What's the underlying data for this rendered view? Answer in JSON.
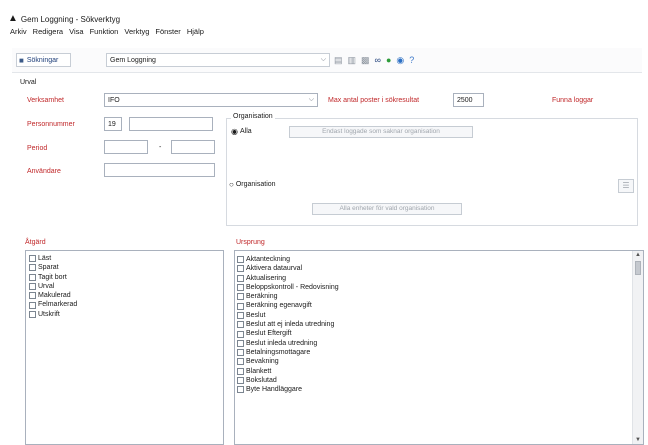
{
  "window": {
    "title": "Gem Loggning - Sökverktyg"
  },
  "menu": [
    "Arkiv",
    "Redigera",
    "Visa",
    "Funktion",
    "Verktyg",
    "Fönster",
    "Hjälp"
  ],
  "toolbar": {
    "saved_search_label": "Sökningar",
    "saved_search_value": "Gem Loggning"
  },
  "urval": {
    "section_label": "Urval",
    "verksamhet_label": "Verksamhet",
    "verksamhet_value": "IFO",
    "max_label": "Max antal poster i sökresultat",
    "max_value": "2500",
    "funna_label": "Funna loggar",
    "personnummer_label": "Personnummer",
    "personnummer_prefix": "19",
    "period_label": "Period",
    "period_separator": "-",
    "anvandare_label": "Användare"
  },
  "organisation": {
    "group_label": "Organisation",
    "radio_alla": "Alla",
    "alla_hint": "Endast loggade som saknar organisation",
    "radio_org": "Organisation",
    "org_button": "Alla enheter för vald organisation"
  },
  "atgard": {
    "label": "Åtgärd",
    "items": [
      "Läst",
      "Sparat",
      "Tagit bort",
      "Urval",
      "Makulerad",
      "Felmarkerad",
      "Utskrift"
    ]
  },
  "ursprung": {
    "label": "Ursprung",
    "items": [
      "Aktanteckning",
      "Aktivera dataurval",
      "Aktualisering",
      "Beloppskontroll - Redovisning",
      "Beräkning",
      "Beräkning egenavgift",
      "Beslut",
      "Beslut att ej inleda utredning",
      "Beslut Eftergift",
      "Beslut inleda utredning",
      "Betalningsmottagare",
      "Bevakning",
      "Blankett",
      "Bokslutad",
      "Byte Handläggare"
    ]
  },
  "colors": {
    "label_red": "#c0282a",
    "window_bg": "#ffffff",
    "panel_border": "#d6dae0"
  }
}
